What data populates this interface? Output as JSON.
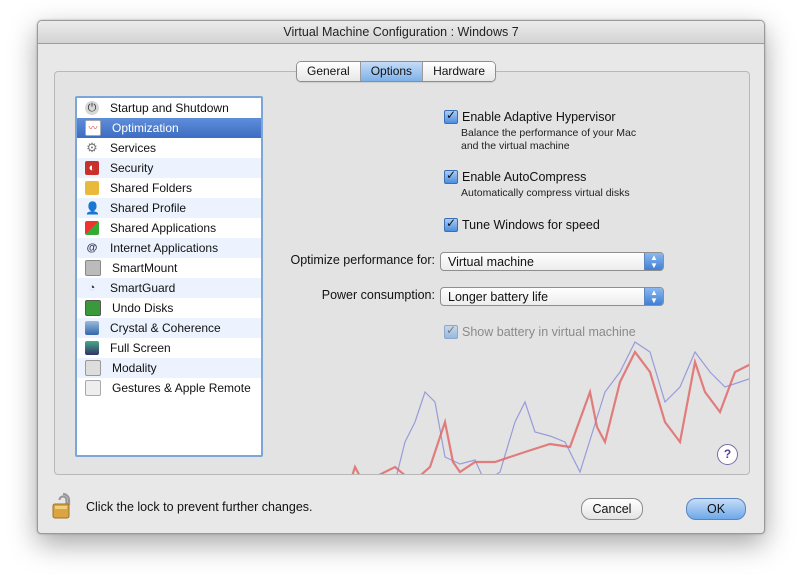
{
  "window": {
    "title": "Virtual Machine Configuration : Windows 7"
  },
  "tabs": [
    {
      "label": "General",
      "active": false
    },
    {
      "label": "Options",
      "active": true
    },
    {
      "label": "Hardware",
      "active": false
    }
  ],
  "sidebar": {
    "items": [
      {
        "label": "Startup and Shutdown",
        "icon": "power-icon",
        "selected": false
      },
      {
        "label": "Optimization",
        "icon": "optimization-icon",
        "selected": true
      },
      {
        "label": "Services",
        "icon": "gear-icon",
        "selected": false
      },
      {
        "label": "Security",
        "icon": "security-icon",
        "selected": false
      },
      {
        "label": "Shared Folders",
        "icon": "folder-icon",
        "selected": false
      },
      {
        "label": "Shared Profile",
        "icon": "profile-icon",
        "selected": false
      },
      {
        "label": "Shared Applications",
        "icon": "applications-icon",
        "selected": false
      },
      {
        "label": "Internet Applications",
        "icon": "at-icon",
        "selected": false
      },
      {
        "label": "SmartMount",
        "icon": "smartmount-icon",
        "selected": false
      },
      {
        "label": "SmartGuard",
        "icon": "smartguard-icon",
        "selected": false
      },
      {
        "label": "Undo Disks",
        "icon": "undo-disk-icon",
        "selected": false
      },
      {
        "label": "Crystal & Coherence",
        "icon": "coherence-icon",
        "selected": false
      },
      {
        "label": "Full Screen",
        "icon": "fullscreen-icon",
        "selected": false
      },
      {
        "label": "Modality",
        "icon": "modality-icon",
        "selected": false
      },
      {
        "label": "Gestures & Apple Remote",
        "icon": "remote-icon",
        "selected": false
      }
    ]
  },
  "options": {
    "adaptive_hypervisor": {
      "label": "Enable Adaptive Hypervisor",
      "checked": true,
      "desc_line1": "Balance the performance of your Mac",
      "desc_line2": "and the virtual machine"
    },
    "autocompress": {
      "label": "Enable AutoCompress",
      "checked": true,
      "desc": "Automatically compress virtual disks"
    },
    "tune_windows": {
      "label": "Tune Windows for speed",
      "checked": true
    },
    "optimize_for": {
      "label": "Optimize performance for:",
      "value": "Virtual machine"
    },
    "power": {
      "label": "Power consumption:",
      "value": "Longer battery life"
    },
    "show_battery": {
      "label": "Show battery in virtual machine",
      "checked": true,
      "disabled": true
    },
    "help_label": "?"
  },
  "footer": {
    "lock_text": "Click the lock to prevent further changes.",
    "cancel_label": "Cancel",
    "ok_label": "OK"
  },
  "colors": {
    "accent": "#3d6cc2",
    "wave_red": "#e06a6a",
    "wave_blue": "#8c8ed8"
  }
}
